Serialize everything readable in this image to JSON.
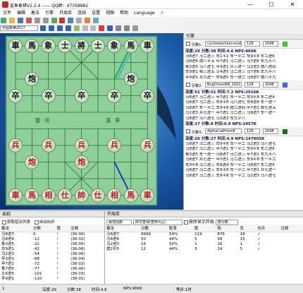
{
  "window": {
    "title": "鲨鱼象棋V2.2.4 —— QQ群：47358882",
    "minimize": "—",
    "maximize": "☐",
    "close": "✕"
  },
  "menu": [
    "文件",
    "编辑",
    "着法",
    "引擎",
    "开局库",
    "连线",
    "设置",
    "视图",
    "帮助",
    "Language"
  ],
  "toolbar": {
    "board_style": "中国象棋2017"
  },
  "board": {
    "pieces": [
      {
        "t": "車",
        "c": "blk",
        "col": 0,
        "row": 0
      },
      {
        "t": "馬",
        "c": "blk",
        "col": 1,
        "row": 0
      },
      {
        "t": "象",
        "c": "blk",
        "col": 2,
        "row": 0
      },
      {
        "t": "士",
        "c": "blk",
        "col": 3,
        "row": 0
      },
      {
        "t": "將",
        "c": "blk",
        "col": 4,
        "row": 0
      },
      {
        "t": "士",
        "c": "blk",
        "col": 5,
        "row": 0
      },
      {
        "t": "象",
        "c": "blk",
        "col": 6,
        "row": 0
      },
      {
        "t": "馬",
        "c": "blk",
        "col": 7,
        "row": 0
      },
      {
        "t": "車",
        "c": "blk",
        "col": 8,
        "row": 0
      },
      {
        "t": "炮",
        "c": "blk",
        "col": 1,
        "row": 2
      },
      {
        "t": "炮",
        "c": "blk",
        "col": 7,
        "row": 2
      },
      {
        "t": "卒",
        "c": "blk",
        "col": 0,
        "row": 3
      },
      {
        "t": "卒",
        "c": "blk",
        "col": 2,
        "row": 3
      },
      {
        "t": "卒",
        "c": "blk",
        "col": 4,
        "row": 3
      },
      {
        "t": "卒",
        "c": "blk",
        "col": 6,
        "row": 3
      },
      {
        "t": "卒",
        "c": "blk",
        "col": 8,
        "row": 3
      },
      {
        "t": "兵",
        "c": "red",
        "col": 0,
        "row": 6
      },
      {
        "t": "兵",
        "c": "red",
        "col": 2,
        "row": 6
      },
      {
        "t": "兵",
        "c": "red",
        "col": 4,
        "row": 6
      },
      {
        "t": "兵",
        "c": "red",
        "col": 6,
        "row": 6
      },
      {
        "t": "兵",
        "c": "red",
        "col": 8,
        "row": 6
      },
      {
        "t": "炮",
        "c": "red",
        "col": 1,
        "row": 7
      },
      {
        "t": "炮",
        "c": "red",
        "col": 4,
        "row": 7
      },
      {
        "t": "車",
        "c": "red",
        "col": 0,
        "row": 9
      },
      {
        "t": "馬",
        "c": "red",
        "col": 1,
        "row": 9
      },
      {
        "t": "相",
        "c": "red",
        "col": 2,
        "row": 9
      },
      {
        "t": "仕",
        "c": "red",
        "col": 3,
        "row": 9
      },
      {
        "t": "帥",
        "c": "red",
        "col": 4,
        "row": 9
      },
      {
        "t": "仕",
        "c": "red",
        "col": 5,
        "row": 9
      },
      {
        "t": "相",
        "c": "red",
        "col": 6,
        "row": 9
      },
      {
        "t": "馬",
        "c": "red",
        "col": 7,
        "row": 9
      }
    ],
    "river_left": "楚 河",
    "river_right": "漢 界",
    "file_numbers": [
      "1",
      "2",
      "3",
      "4",
      "5",
      "6",
      "7",
      "8",
      "9"
    ]
  },
  "engine_panel": {
    "title": "引擎",
    "engines": [
      {
        "label": "引擎1:",
        "name": "cycloneschess-eval",
        "hash": "128",
        "threads": "2048",
        "color": "#33cc33",
        "stat": "深度:29 分数:38 时间:4.6 NPS:966K",
        "lines": [
          "马8进7 马二进三 车1平2 车一平二 车9平8 车二进6",
          "马8进6 炮八平五 卒7进1 马二进三 马7进6 车九平八",
          "象3进5 马八进七 卒3进1 兵三进一 马2进3 炮八进四",
          "车9进1 相三进五 士4进5 马二进三 马7进6 车九平八",
          "卒9进1 兵九进一 车9进5 车一进二 马8进7 炮八平九",
          "马2进3 马八进九 象7进5 兵三进一 卒3进1 车九平八"
        ]
      },
      {
        "label": "引擎2:",
        "name": "BugChessNN_2021",
        "hash": "128",
        "threads": "2048",
        "color": "#3366ff",
        "stat": "深度:51 分数:51 时间:7.2 NPS:2016K",
        "lines": [
          "马8进7 马二进三 卒7进1 车一平二 车9平8 车二进4",
          "马8进7 马二进三 车9平8 马八进七 车8进4 车一进一",
          "马8进7 车一平二 车9平8 炮二进四 卒7进1 相七进五",
          "马2进3 兵七进一 卒7进1 马二进三 马8进7 车一进一",
          "马8进7 马八进七 马2进3 车九平八"
        ],
        "stat2": "深度:17 分数:8 时间:6.0 NPS:1957K"
      },
      {
        "label": "引擎3:",
        "name": "AlphaCatPrismE",
        "hash": "128",
        "threads": "2048",
        "color": "#117711",
        "stat": "深度:26 分数:27 时间:4.9 NPS:147005K",
        "lines": [
          "马8进7 马二进三 车9平8 车一平二 马2进3 马八进七",
          "马8进7 马二进三 卒7进1 车一平二 车9平8 车二进6",
          "象3进5 车一进一 马8进7 马二进三 卒7进1 车九平八",
          "马8进7 兵七进一 卒7进1 马二进三 车9平8 车一平二",
          "车9平8 马二进三 车8进4 车一平二 马8进7 车二进6",
          "马8进7 马二进三 车9平8 车一平二 卒7进1 兵七进一",
          "马8进7 马二进三 车9平8 车一平二 马2进3 马八进七",
          "卒7进1 马二进三 马8进7 车一平二 车9平8 车二进6",
          "马8进7 兵七进一 马2进3 马八进七 象7进5 车九平八"
        ]
      }
    ]
  },
  "output_panel": {
    "title": "出招",
    "cb1": "获取招法列表",
    "cb2": "自动出步",
    "headers": [
      "着法",
      "分数",
      "胜",
      "注释"
    ],
    "rows": [
      [
        "马8进7",
        "0",
        "!",
        "(36-00)"
      ],
      [
        "马8进6",
        "-12",
        "!",
        "(36-02)"
      ],
      [
        "象3进5",
        "-22",
        "!",
        "(36-05)"
      ],
      [
        "车9进1",
        "-42",
        "!",
        "(36-06)"
      ],
      [
        "马2进3",
        "-54",
        "!",
        "(36-06)"
      ],
      [
        "卒3进1",
        "-68",
        "!",
        "(36-04)"
      ],
      [
        "卒7进1",
        "-72",
        "!",
        "(36-02)"
      ],
      [
        "象7进5",
        "-77",
        "!",
        "(36-00)"
      ],
      [
        "士6进5",
        "-101",
        "!",
        "(36-03)"
      ],
      [
        "卒9进1",
        "-110",
        "!",
        "(36-01)"
      ]
    ]
  },
  "ctrl_panel": {
    "title": "开局库",
    "c1": "最佳招数",
    "c2": "依次查询(查到为止)",
    "c3": "按序显示开局",
    "c4": "按分数",
    "headers": [
      "着法",
      "分数",
      "胜率",
      "胜",
      "和",
      "负",
      "允许",
      "注释"
    ],
    "rows": [
      [
        "马8进7",
        "9999",
        "54%",
        "119",
        "876",
        "18",
        "✓",
        ""
      ],
      [
        "马8进6",
        "50",
        "44%",
        "5",
        "58",
        "15",
        "✓",
        ""
      ],
      [
        "马2进3",
        "16",
        "50%",
        "1",
        "16",
        "1",
        "✓",
        ""
      ],
      [
        "炮2平5",
        "12",
        "44%",
        "3",
        "24",
        "5",
        "✓",
        ""
      ]
    ]
  },
  "status": {
    "s1": "深度:29",
    "s2": "分数:38",
    "s3": "时间:4.6",
    "s4": "NPS:966K",
    "s5": "1",
    "s6": "等步:1时"
  }
}
